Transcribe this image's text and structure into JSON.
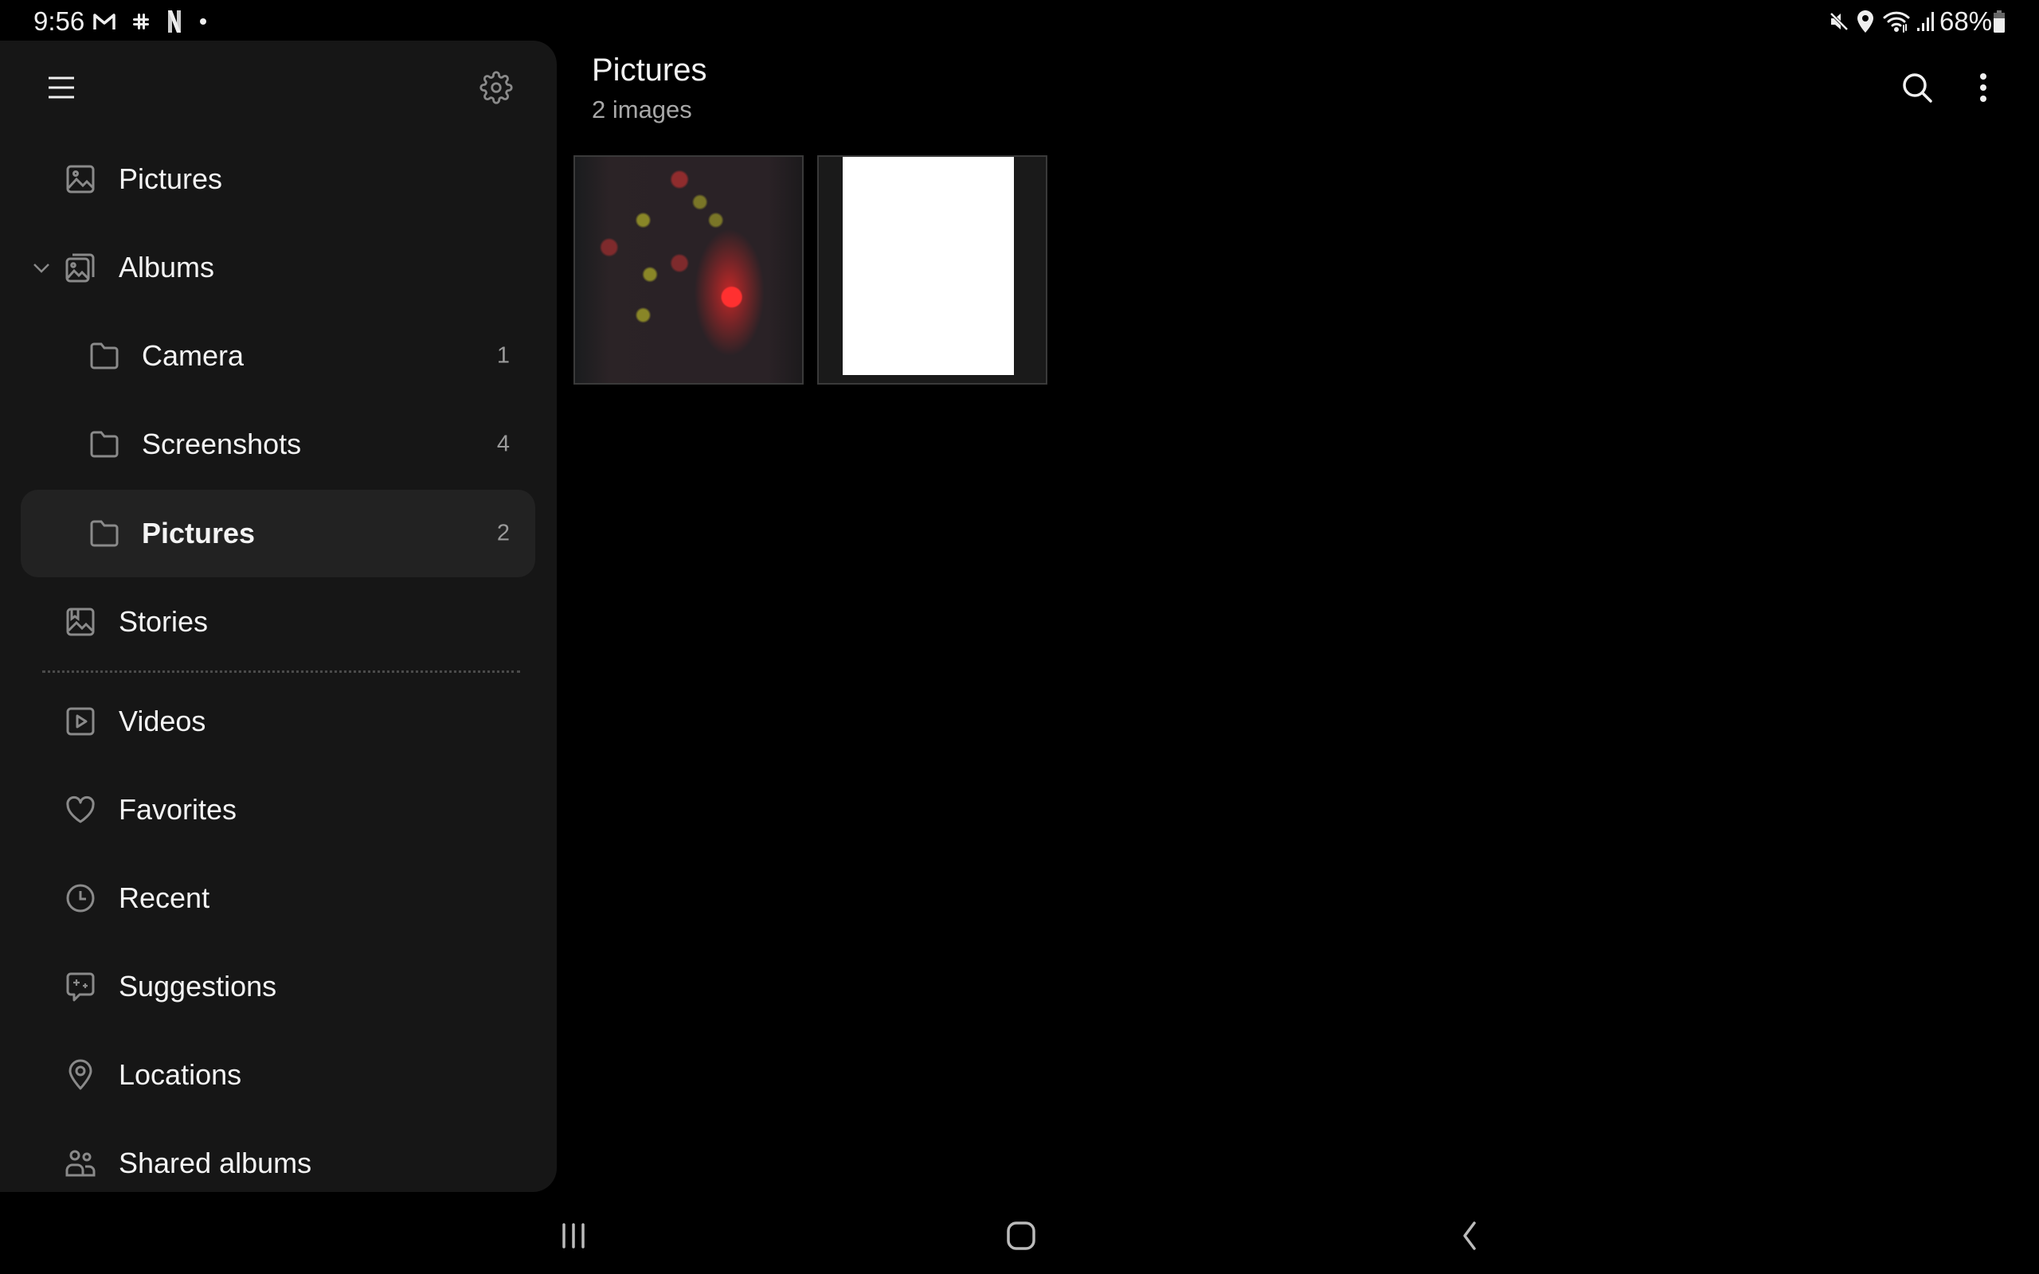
{
  "status_bar": {
    "time": "9:56",
    "notification_icons": [
      "gmail-icon",
      "slack-icon",
      "netflix-icon",
      "more-dot-icon"
    ],
    "system_icons": [
      "mute-icon",
      "location-icon",
      "wifi-icon",
      "signal-icon",
      "battery-icon"
    ],
    "battery_percent": "68%"
  },
  "sidebar": {
    "menu_icon": "hamburger-icon",
    "settings_icon": "gear-icon",
    "items": [
      {
        "label": "Pictures",
        "icon": "image-icon"
      },
      {
        "label": "Albums",
        "icon": "albums-icon",
        "expanded": true
      },
      {
        "label": "Camera",
        "icon": "folder-icon",
        "count": "1",
        "sub": true
      },
      {
        "label": "Screenshots",
        "icon": "folder-icon",
        "count": "4",
        "sub": true
      },
      {
        "label": "Pictures",
        "icon": "folder-icon",
        "count": "2",
        "sub": true,
        "selected": true
      },
      {
        "label": "Stories",
        "icon": "stories-icon"
      },
      {
        "label": "Videos",
        "icon": "video-icon"
      },
      {
        "label": "Favorites",
        "icon": "heart-icon"
      },
      {
        "label": "Recent",
        "icon": "clock-icon"
      },
      {
        "label": "Suggestions",
        "icon": "suggestions-icon"
      },
      {
        "label": "Locations",
        "icon": "location-pin-icon"
      },
      {
        "label": "Shared albums",
        "icon": "people-icon"
      }
    ]
  },
  "header": {
    "title": "Pictures",
    "subtitle": "2 images",
    "actions": [
      "search-icon",
      "more-vert-icon"
    ]
  },
  "grid": {
    "thumbnails": [
      {
        "description": "dark image with red and yellow blurred shapes"
      },
      {
        "description": "white sheet of paper on dark background"
      }
    ]
  },
  "nav_bar": {
    "buttons": [
      "recents",
      "home",
      "back"
    ]
  },
  "colors": {
    "background": "#000000",
    "sidebar_bg": "#161616",
    "selected_bg": "#222222",
    "text_primary": "#f4f4f4",
    "text_secondary": "#a8a8a8",
    "icon_gray": "#8a8a8a"
  }
}
